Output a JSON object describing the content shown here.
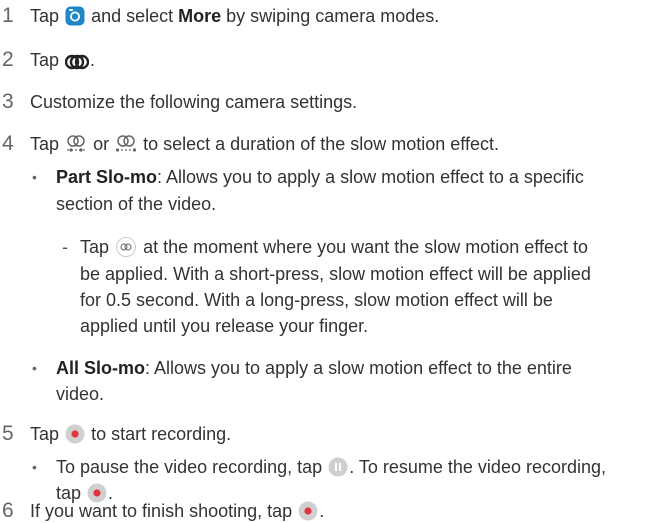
{
  "steps": [
    {
      "num": "1",
      "pre": "Tap",
      "mid": "and select",
      "bold": "More",
      "post": "by swiping camera modes."
    },
    {
      "num": "2",
      "pre": "Tap",
      "post": "."
    },
    {
      "num": "3",
      "text": "Customize the following camera settings."
    },
    {
      "num": "4",
      "pre": "Tap",
      "mid": "or",
      "post": "to select a duration of the slow motion effect."
    },
    {
      "num": "5",
      "pre": "Tap",
      "post": "to start recording."
    },
    {
      "num": "6",
      "pre": "If you want to finish shooting, tap",
      "post": "."
    }
  ],
  "part_slomo": {
    "bullet": "•",
    "title": "Part Slo-mo",
    "line1": ": Allows you to apply a slow motion effect to a specific",
    "line2": "section of the video."
  },
  "dash_item": {
    "dash": "-",
    "pre": "Tap",
    "line1_post": "at the moment where you want the slow motion effect to",
    "line2": "be applied. With a short-press, slow motion effect will be applied",
    "line3": "for 0.5 second. With a long-press, slow motion effect will be",
    "line4": "applied until you release your finger."
  },
  "all_slomo": {
    "bullet": "•",
    "title": "All Slo-mo",
    "line1": ": Allows you to apply a slow motion effect to the entire",
    "line2": "video."
  },
  "pause_item": {
    "bullet": "•",
    "line1_pre": "To pause the video recording, tap",
    "line1_post": ". To resume the video recording,",
    "line2_pre": "tap",
    "line2_post": "."
  },
  "colors": {
    "text": "#333333",
    "icon_blue": "#1f86c7",
    "icon_red": "#e2343f",
    "icon_gray": "#d0d0d0"
  },
  "icons": [
    "camera-app-icon",
    "slow-motion-icon",
    "part-slomo-icon",
    "all-slomo-icon",
    "slomo-button-icon",
    "record-icon",
    "pause-icon"
  ]
}
